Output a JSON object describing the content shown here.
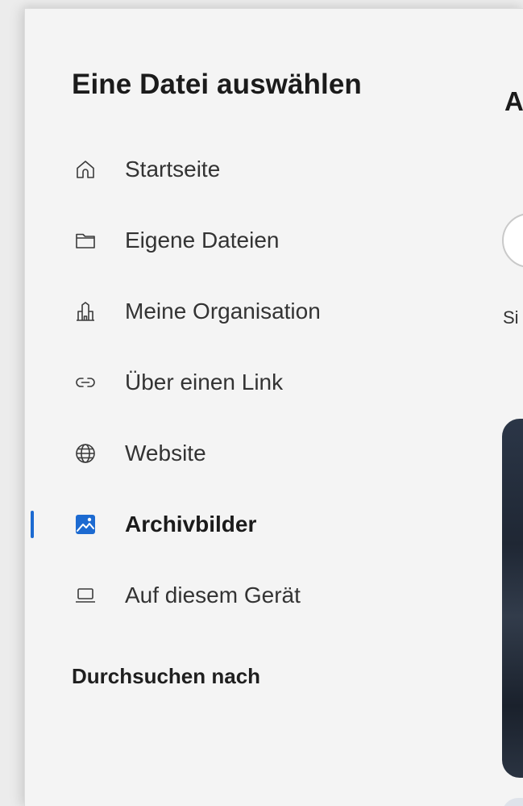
{
  "dialog": {
    "title": "Eine Datei auswählen"
  },
  "nav": {
    "items": [
      {
        "label": "Startseite",
        "icon": "home-icon",
        "selected": false
      },
      {
        "label": "Eigene Dateien",
        "icon": "folder-icon",
        "selected": false
      },
      {
        "label": "Meine Organisation",
        "icon": "organization-icon",
        "selected": false
      },
      {
        "label": "Über einen Link",
        "icon": "link-icon",
        "selected": false
      },
      {
        "label": "Website",
        "icon": "globe-icon",
        "selected": false
      },
      {
        "label": "Archivbilder",
        "icon": "stock-images-icon",
        "selected": true
      },
      {
        "label": "Auf diesem Gerät",
        "icon": "laptop-icon",
        "selected": false
      }
    ],
    "section_heading": "Durchsuchen nach"
  },
  "right_pane": {
    "heading_fragment": "A",
    "text_fragment": "Si"
  },
  "colors": {
    "accent": "#1c6ad1",
    "background": "#f4f4f4",
    "text": "#1b1b1b"
  }
}
